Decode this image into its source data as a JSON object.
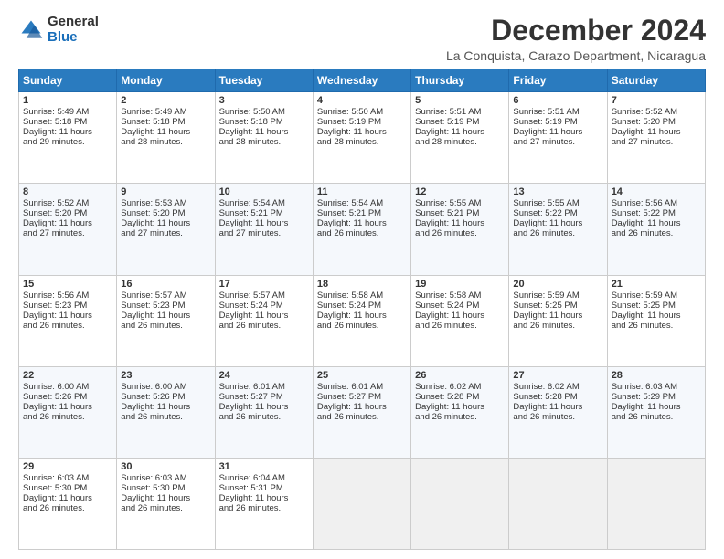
{
  "header": {
    "logo_general": "General",
    "logo_blue": "Blue",
    "month_title": "December 2024",
    "location": "La Conquista, Carazo Department, Nicaragua"
  },
  "days_of_week": [
    "Sunday",
    "Monday",
    "Tuesday",
    "Wednesday",
    "Thursday",
    "Friday",
    "Saturday"
  ],
  "weeks": [
    [
      {
        "day": 1,
        "rise": "5:49 AM",
        "set": "5:18 PM",
        "hours": "11 hours",
        "mins": "29 minutes"
      },
      {
        "day": 2,
        "rise": "5:49 AM",
        "set": "5:18 PM",
        "hours": "11 hours",
        "mins": "28 minutes"
      },
      {
        "day": 3,
        "rise": "5:50 AM",
        "set": "5:18 PM",
        "hours": "11 hours",
        "mins": "28 minutes"
      },
      {
        "day": 4,
        "rise": "5:50 AM",
        "set": "5:19 PM",
        "hours": "11 hours",
        "mins": "28 minutes"
      },
      {
        "day": 5,
        "rise": "5:51 AM",
        "set": "5:19 PM",
        "hours": "11 hours",
        "mins": "28 minutes"
      },
      {
        "day": 6,
        "rise": "5:51 AM",
        "set": "5:19 PM",
        "hours": "11 hours",
        "mins": "27 minutes"
      },
      {
        "day": 7,
        "rise": "5:52 AM",
        "set": "5:20 PM",
        "hours": "11 hours",
        "mins": "27 minutes"
      }
    ],
    [
      {
        "day": 8,
        "rise": "5:52 AM",
        "set": "5:20 PM",
        "hours": "11 hours",
        "mins": "27 minutes"
      },
      {
        "day": 9,
        "rise": "5:53 AM",
        "set": "5:20 PM",
        "hours": "11 hours",
        "mins": "27 minutes"
      },
      {
        "day": 10,
        "rise": "5:54 AM",
        "set": "5:21 PM",
        "hours": "11 hours",
        "mins": "27 minutes"
      },
      {
        "day": 11,
        "rise": "5:54 AM",
        "set": "5:21 PM",
        "hours": "11 hours",
        "mins": "26 minutes"
      },
      {
        "day": 12,
        "rise": "5:55 AM",
        "set": "5:21 PM",
        "hours": "11 hours",
        "mins": "26 minutes"
      },
      {
        "day": 13,
        "rise": "5:55 AM",
        "set": "5:22 PM",
        "hours": "11 hours",
        "mins": "26 minutes"
      },
      {
        "day": 14,
        "rise": "5:56 AM",
        "set": "5:22 PM",
        "hours": "11 hours",
        "mins": "26 minutes"
      }
    ],
    [
      {
        "day": 15,
        "rise": "5:56 AM",
        "set": "5:23 PM",
        "hours": "11 hours",
        "mins": "26 minutes"
      },
      {
        "day": 16,
        "rise": "5:57 AM",
        "set": "5:23 PM",
        "hours": "11 hours",
        "mins": "26 minutes"
      },
      {
        "day": 17,
        "rise": "5:57 AM",
        "set": "5:24 PM",
        "hours": "11 hours",
        "mins": "26 minutes"
      },
      {
        "day": 18,
        "rise": "5:58 AM",
        "set": "5:24 PM",
        "hours": "11 hours",
        "mins": "26 minutes"
      },
      {
        "day": 19,
        "rise": "5:58 AM",
        "set": "5:24 PM",
        "hours": "11 hours",
        "mins": "26 minutes"
      },
      {
        "day": 20,
        "rise": "5:59 AM",
        "set": "5:25 PM",
        "hours": "11 hours",
        "mins": "26 minutes"
      },
      {
        "day": 21,
        "rise": "5:59 AM",
        "set": "5:25 PM",
        "hours": "11 hours",
        "mins": "26 minutes"
      }
    ],
    [
      {
        "day": 22,
        "rise": "6:00 AM",
        "set": "5:26 PM",
        "hours": "11 hours",
        "mins": "26 minutes"
      },
      {
        "day": 23,
        "rise": "6:00 AM",
        "set": "5:26 PM",
        "hours": "11 hours",
        "mins": "26 minutes"
      },
      {
        "day": 24,
        "rise": "6:01 AM",
        "set": "5:27 PM",
        "hours": "11 hours",
        "mins": "26 minutes"
      },
      {
        "day": 25,
        "rise": "6:01 AM",
        "set": "5:27 PM",
        "hours": "11 hours",
        "mins": "26 minutes"
      },
      {
        "day": 26,
        "rise": "6:02 AM",
        "set": "5:28 PM",
        "hours": "11 hours",
        "mins": "26 minutes"
      },
      {
        "day": 27,
        "rise": "6:02 AM",
        "set": "5:28 PM",
        "hours": "11 hours",
        "mins": "26 minutes"
      },
      {
        "day": 28,
        "rise": "6:03 AM",
        "set": "5:29 PM",
        "hours": "11 hours",
        "mins": "26 minutes"
      }
    ],
    [
      {
        "day": 29,
        "rise": "6:03 AM",
        "set": "5:30 PM",
        "hours": "11 hours",
        "mins": "26 minutes"
      },
      {
        "day": 30,
        "rise": "6:03 AM",
        "set": "5:30 PM",
        "hours": "11 hours",
        "mins": "26 minutes"
      },
      {
        "day": 31,
        "rise": "6:04 AM",
        "set": "5:31 PM",
        "hours": "11 hours",
        "mins": "26 minutes"
      },
      null,
      null,
      null,
      null
    ]
  ]
}
